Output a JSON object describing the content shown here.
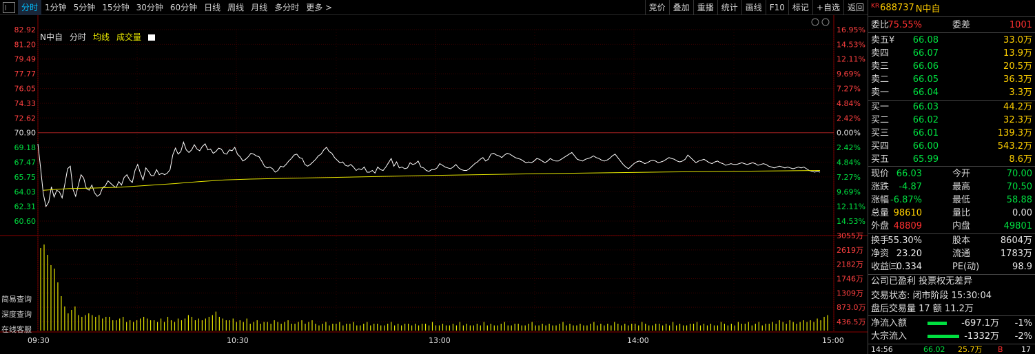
{
  "toolbar": {
    "periods": [
      "分时",
      "1分钟",
      "5分钟",
      "15分钟",
      "30分钟",
      "60分钟",
      "日线",
      "周线",
      "月线",
      "多分时",
      "更多 >"
    ],
    "active_index": 0,
    "tools": [
      "竞价",
      "叠加",
      "重播",
      "统计",
      "画线",
      "F10",
      "标记",
      "+自选",
      "返回"
    ]
  },
  "legend": {
    "name": "N中自",
    "fenshi": "分时",
    "avg": "均线",
    "vol": "成交量"
  },
  "side_buttons": [
    "简易查询",
    "深度查询",
    "在线客服"
  ],
  "chart_data": {
    "type": "line",
    "price_ticks": [
      "82.92",
      "81.20",
      "79.49",
      "77.77",
      "76.05",
      "74.33",
      "72.62",
      "70.90",
      "69.18",
      "67.47",
      "65.75",
      "64.03",
      "62.31",
      "60.60"
    ],
    "pct_ticks": [
      "16.95%",
      "14.53%",
      "12.11%",
      "9.69%",
      "7.27%",
      "4.84%",
      "2.42%",
      "0.00%",
      "2.42%",
      "4.84%",
      "7.27%",
      "9.69%",
      "12.11%",
      "14.53%"
    ],
    "vol_ticks": [
      "3055万",
      "2619万",
      "2182万",
      "1746万",
      "1309万",
      "873.0万",
      "436.5万"
    ],
    "time_ticks": [
      "09:30",
      "10:30",
      "13:00",
      "14:00",
      "15:00"
    ],
    "prev_close": 70.9,
    "price_series": [
      69.6,
      66.8,
      63.8,
      62.3,
      62.8,
      64.6,
      63.4,
      64.2,
      64.0,
      63.3,
      64.9,
      66.7,
      67.0,
      64.3,
      63.5,
      64.8,
      66.0,
      65.6,
      64.4,
      64.2,
      64.8,
      63.9,
      63.5,
      63.7,
      64.5,
      64.7,
      65.3,
      65.0,
      64.7,
      64.5,
      65.2,
      64.8,
      65.7,
      66.0,
      65.4,
      65.1,
      66.5,
      67.2,
      66.2,
      65.4,
      66.8,
      66.4,
      65.9,
      65.9,
      66.6,
      66.0,
      66.2,
      66.0,
      66.2,
      66.6,
      68.3,
      69.1,
      68.4,
      68.7,
      69.8,
      68.9,
      68.6,
      68.9,
      69.5,
      69.0,
      68.8,
      69.3,
      69.6,
      68.9,
      69.0,
      68.5,
      68.7,
      69.1,
      69.0,
      68.5,
      68.4,
      68.9,
      68.8,
      69.2,
      68.4,
      68.1,
      67.6,
      67.8,
      68.1,
      68.5,
      68.4,
      68.2,
      68.1,
      67.6,
      67.0,
      66.8,
      66.9,
      66.7,
      66.3,
      66.5,
      67.0,
      66.9,
      67.2,
      67.6,
      67.9,
      68.3,
      68.4,
      68.0,
      67.9,
      67.2,
      67.0,
      67.2,
      67.5,
      67.8,
      68.2,
      68.4,
      68.9,
      69.2,
      68.7,
      68.5,
      68.0,
      67.7,
      67.4,
      67.5,
      67.1,
      67.0,
      67.2,
      66.9,
      66.5,
      66.7,
      66.6,
      66.9,
      66.3,
      66.3,
      66.5,
      66.2,
      66.9,
      66.6,
      66.5,
      66.9,
      67.4,
      67.9,
      67.0,
      67.5,
      66.8,
      66.9,
      66.7,
      66.8,
      67.4,
      67.2,
      67.3,
      67.6,
      66.9,
      66.8,
      66.5,
      66.4,
      66.6,
      66.6,
      66.8,
      67.3,
      67.1,
      66.9,
      66.8,
      66.7,
      66.9,
      67.2,
      66.8,
      66.6,
      66.5,
      66.5,
      66.7,
      67.0,
      67.3,
      67.5,
      67.8,
      68.0,
      67.6,
      67.8,
      68.4,
      68.5,
      68.3,
      68.2,
      68.0,
      68.3,
      68.5,
      68.4,
      68.2,
      68.0,
      67.9,
      67.8,
      67.6,
      67.4,
      67.5,
      67.4,
      67.6,
      67.9,
      67.8,
      67.6,
      67.4,
      67.6,
      67.9,
      67.7,
      67.6,
      67.6,
      67.8,
      68.0,
      68.2,
      68.4,
      68.6,
      68.2,
      67.8,
      67.7,
      67.6,
      67.8,
      67.9,
      68.0,
      68.2,
      68.0,
      67.9,
      67.7,
      67.6,
      67.7,
      67.9,
      68.2,
      68.4,
      68.0,
      67.6,
      67.2,
      66.9,
      66.7,
      67.0,
      67.3,
      67.5,
      67.6,
      67.5,
      67.3,
      67.4,
      67.6,
      67.7,
      67.6,
      67.4,
      67.5,
      67.6,
      67.8,
      68.0,
      67.9,
      67.8,
      67.6,
      67.5,
      67.6,
      67.8,
      68.3,
      68.0,
      67.7,
      67.4,
      67.6,
      67.7,
      67.8,
      67.6,
      67.4,
      67.3,
      67.5,
      67.6,
      67.4,
      67.3,
      67.1,
      67.2,
      67.3,
      67.2,
      67.2,
      67.3,
      67.4,
      67.3,
      67.2,
      67.3,
      67.4,
      67.3,
      67.1,
      67.2,
      67.3,
      67.2,
      67.0,
      66.9,
      66.8,
      66.9,
      67.0,
      66.9,
      66.8,
      66.9,
      66.8,
      66.7,
      66.8,
      66.9,
      66.8,
      66.9,
      66.7,
      66.5,
      66.4,
      66.3,
      66.4,
      66.3
    ],
    "avg_series": [
      64.2,
      64.4,
      64.45,
      64.55,
      64.75,
      64.95,
      65.2,
      65.4,
      65.5,
      65.56,
      65.62,
      65.68,
      65.74,
      65.8,
      65.86,
      65.92,
      65.97,
      66.02,
      66.07,
      66.12,
      66.16,
      66.2,
      66.24,
      66.28,
      66.32,
      66.35,
      66.38,
      66.41,
      66.44,
      66.47,
      66.5
    ],
    "vol_series": [
      48,
      50,
      44,
      38,
      36,
      28,
      20,
      14,
      10,
      12,
      14,
      9,
      8,
      9,
      10,
      9,
      8,
      9,
      7,
      8,
      8,
      6,
      6,
      7,
      8,
      5,
      6,
      5,
      6,
      7,
      8,
      7,
      6,
      6,
      5,
      7,
      5,
      8,
      6,
      5,
      7,
      6,
      7,
      9,
      8,
      6,
      7,
      6,
      7,
      8,
      9,
      11,
      8,
      7,
      6,
      6,
      7,
      5,
      6,
      5,
      7,
      4,
      5,
      6,
      4,
      5,
      5,
      4,
      6,
      5,
      4,
      5,
      6,
      4,
      4,
      5,
      6,
      4,
      5,
      6,
      4,
      3,
      4,
      5,
      3,
      4,
      4,
      5,
      3,
      4,
      4,
      5,
      3,
      3,
      4,
      5,
      3,
      4,
      4,
      3,
      3,
      4,
      5,
      3,
      4,
      3,
      4,
      4,
      3,
      4,
      3,
      4,
      4,
      3,
      5,
      3,
      3,
      4,
      3,
      3,
      4,
      3,
      5,
      3,
      4,
      3,
      3,
      4,
      3,
      5,
      3,
      4,
      3,
      3,
      4,
      5,
      3,
      3,
      4,
      4,
      3,
      3,
      4,
      5,
      3,
      3,
      4,
      3,
      4,
      3,
      3,
      4,
      5,
      3,
      4,
      3,
      3,
      4,
      3,
      3,
      4,
      5,
      3,
      4,
      3,
      4,
      3,
      5,
      4,
      3,
      4,
      3,
      4,
      4,
      3,
      5,
      4,
      3,
      3,
      4,
      4,
      3,
      4,
      3,
      5,
      3,
      4,
      3,
      3,
      4,
      4,
      5,
      3,
      4,
      3,
      4,
      3,
      3,
      5,
      4,
      3,
      4,
      3,
      5,
      4,
      4,
      5,
      3,
      4,
      5,
      3,
      4,
      4,
      5,
      4,
      6,
      5,
      4,
      6,
      5,
      4,
      5,
      6,
      5,
      6,
      5,
      7,
      6,
      8,
      9
    ]
  },
  "panel": {
    "kr": "KR",
    "code": "688737",
    "name": "N中自",
    "weibi_label": "委比",
    "weibi": "75.55%",
    "weicha_label": "委差",
    "weicha": "1001",
    "sells": [
      {
        "label": "卖五¥",
        "price": "66.08",
        "vol": "33.0万"
      },
      {
        "label": "卖四",
        "price": "66.07",
        "vol": "13.9万"
      },
      {
        "label": "卖三",
        "price": "66.06",
        "vol": "20.5万"
      },
      {
        "label": "卖二",
        "price": "66.05",
        "vol": "36.3万"
      },
      {
        "label": "卖一",
        "price": "66.04",
        "vol": "3.3万"
      }
    ],
    "buys": [
      {
        "label": "买一",
        "price": "66.03",
        "vol": "44.2万"
      },
      {
        "label": "买二",
        "price": "66.02",
        "vol": "32.3万"
      },
      {
        "label": "买三",
        "price": "66.01",
        "vol": "139.3万"
      },
      {
        "label": "买四",
        "price": "66.00",
        "vol": "543.2万"
      },
      {
        "label": "买五",
        "price": "65.99",
        "vol": "8.6万"
      }
    ],
    "quote": [
      {
        "l1": "现价",
        "v1": "66.03",
        "c1": "green",
        "l2": "今开",
        "v2": "70.00",
        "c2": "green"
      },
      {
        "l1": "涨跌",
        "v1": "-4.87",
        "c1": "green",
        "l2": "最高",
        "v2": "70.50",
        "c2": "green"
      },
      {
        "l1": "涨幅",
        "v1": "-6.87%",
        "c1": "green",
        "l2": "最低",
        "v2": "58.88",
        "c2": "green"
      },
      {
        "l1": "总量",
        "v1": "98610",
        "c1": "yellow",
        "l2": "量比",
        "v2": "0.00",
        "c2": "white"
      },
      {
        "l1": "外盘",
        "v1": "48809",
        "c1": "red",
        "l2": "内盘",
        "v2": "49801",
        "c2": "green"
      }
    ],
    "fund": [
      {
        "l1": "换手",
        "v1": "55.30%",
        "l2": "股本",
        "v2": "8604万"
      },
      {
        "l1": "净资",
        "v1": "23.20",
        "l2": "流通",
        "v2": "1783万"
      },
      {
        "l1": "收益㈢",
        "v1": "0.334",
        "l2": "PE(动)",
        "v2": "98.9"
      }
    ],
    "company_note": "公司已盈利 投票权无差异",
    "trade_status": "交易状态: 闭市阶段 15:30:04",
    "after_hours": "盘后交易量 17 额 11.2万",
    "flows": [
      {
        "label": "净流入额",
        "value": "-697.1万",
        "pct": "-1%"
      },
      {
        "label": "大宗流入",
        "value": "-1332万",
        "pct": "-2%"
      }
    ],
    "tick_row": {
      "time": "14:56",
      "price": "66.02",
      "vol": "25.7万",
      "side": "B",
      "num": "17"
    }
  },
  "colors": {
    "up": "#ff3030",
    "down": "#00e040",
    "price_line": "#ffffff",
    "avg_line": "#e8e800",
    "vol_bar": "#e8e800",
    "grid": "#3a0000"
  }
}
